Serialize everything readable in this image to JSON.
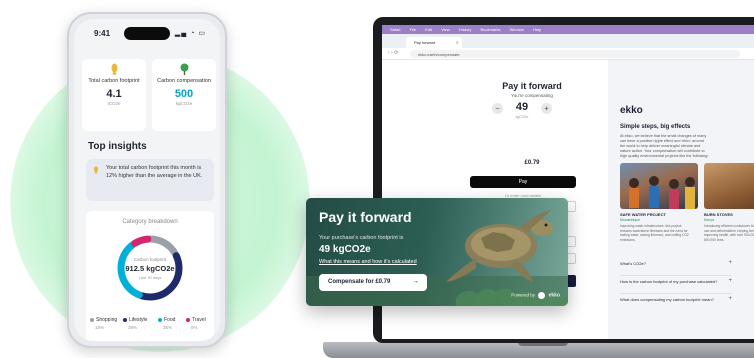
{
  "colors": {
    "glow": "#c8f5d5",
    "accent": "#00a6c8",
    "brand_dark": "#1e2235",
    "card_green": "#2c5e54"
  },
  "phone": {
    "time": "9:41",
    "cards": [
      {
        "icon": "footprint-icon",
        "label": "Total carbon footprint",
        "value": "4.1",
        "unit": "tCO2e"
      },
      {
        "icon": "tree-icon",
        "label": "Carbon compensation",
        "value": "500",
        "unit": "kgCO2e"
      }
    ],
    "insights_title": "Top insights",
    "insight_text": "Your total carbon footprint this month is 12% higher than the average in the UK.",
    "category_title": "Category breakdown",
    "donut": {
      "label": "Carbon footprint",
      "value": "912.5 kgCO2e",
      "period": "Last 30 days"
    },
    "breakdown": [
      {
        "name": "Shopping",
        "pct": "18%",
        "color": "#9aa0a8",
        "value": 18
      },
      {
        "name": "Lifestyle",
        "pct": "38%",
        "color": "#1e2a6b",
        "value": 38
      },
      {
        "name": "Food",
        "pct": "35%",
        "color": "#00b0d8",
        "value": 35
      },
      {
        "name": "Travel",
        "pct": "9%",
        "color": "#d6246e",
        "value": 9
      }
    ]
  },
  "laptop": {
    "menu_items": [
      "Safari",
      "File",
      "Edit",
      "View",
      "History",
      "Bookmarks",
      "Window",
      "Help"
    ],
    "tab_title": "Pay forward",
    "url": "ekko.earth/compensate",
    "title": "Pay it forward",
    "compensating_label": "You're compensating",
    "amount": "49",
    "amount_unit": "kgCO2e",
    "price": "£0.79",
    "apple_pay": "Pay",
    "or_label": "Or enter card details",
    "right": {
      "brand": "ekko",
      "heading": "Simple steps, big effects",
      "paragraph": "At ekko, we believe that the small changes of many can have a positive ripple effect and 'ekko' around the world to help deliver meaningful climate and nature action. Your compensation will contribute to high quality environmental projects like the following:",
      "projects": [
        {
          "title": "SAFE WATER PROJECT",
          "location": "Mozambique",
          "desc": "Improving water infrastructure, this project reduces waterborne illnesses and the need for boiling water, saving firewood, and cutting CO2 emissions."
        },
        {
          "title": "BURN STOVES",
          "location": "Kenya",
          "desc": "Introducing efficient cookstoves that cut charcoal use and deforestation, helping families cook, and improving health, with over 900,000 distributed to 800,000 lives."
        }
      ],
      "faqs": [
        "What's CO2e?",
        "How is the carbon footprint of my purchase calculated?",
        "What does compensating my carbon footprint mean?"
      ]
    }
  },
  "card": {
    "title": "Pay it forward",
    "subtitle": "Your purchase's carbon footprint is",
    "value": "49 kgCO2e",
    "link": "What this means and how it's calculated",
    "button": "Compensate for £0.79",
    "powered_by": "Powered by",
    "powered_brand": "ekko"
  }
}
